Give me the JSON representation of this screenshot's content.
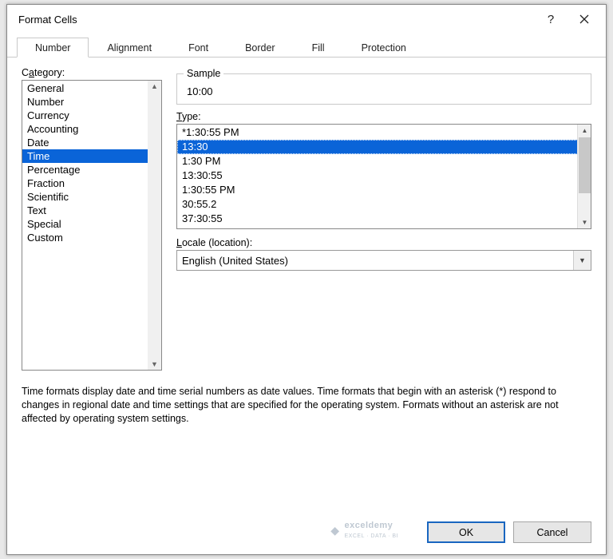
{
  "dialog": {
    "title": "Format Cells"
  },
  "tabs": [
    "Number",
    "Alignment",
    "Font",
    "Border",
    "Fill",
    "Protection"
  ],
  "active_tab": 0,
  "category": {
    "label_pre": "C",
    "label_u": "a",
    "label_post": "tegory:",
    "items": [
      "General",
      "Number",
      "Currency",
      "Accounting",
      "Date",
      "Time",
      "Percentage",
      "Fraction",
      "Scientific",
      "Text",
      "Special",
      "Custom"
    ],
    "selected_index": 5
  },
  "sample": {
    "legend": "Sample",
    "value": "10:00"
  },
  "type": {
    "label_u": "T",
    "label_post": "ype:",
    "items": [
      "*1:30:55 PM",
      "13:30",
      "1:30 PM",
      "13:30:55",
      "1:30:55 PM",
      "30:55.2",
      "37:30:55"
    ],
    "selected_index": 1
  },
  "locale": {
    "label_u": "L",
    "label_post": "ocale (location):",
    "value": "English (United States)"
  },
  "description": "Time formats display date and time serial numbers as date values.  Time formats that begin with an asterisk (*) respond to changes in regional date and time settings that are specified for the operating system. Formats without an asterisk are not affected by operating system settings.",
  "buttons": {
    "ok": "OK",
    "cancel": "Cancel"
  },
  "watermark": {
    "brand": "exceldemy",
    "tagline": "EXCEL · DATA · BI"
  }
}
